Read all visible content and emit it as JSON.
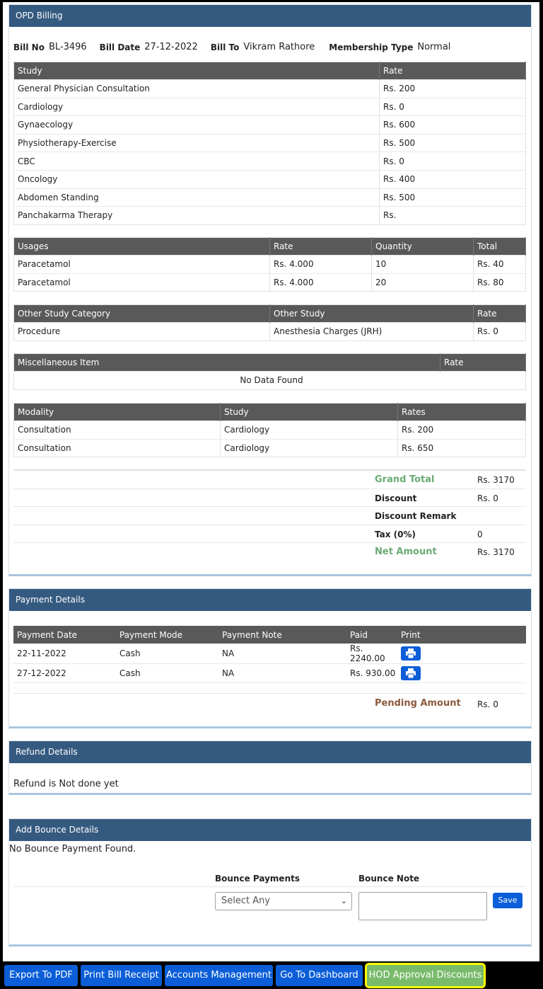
{
  "opd": {
    "title": "OPD Billing",
    "bill_no_label": "Bill No",
    "bill_no": "BL-3496",
    "bill_date_label": "Bill Date",
    "bill_date": "27-12-2022",
    "bill_to_label": "Bill To",
    "bill_to": "Vikram Rathore",
    "membership_label": "Membership Type",
    "membership": "Normal"
  },
  "study_table": {
    "headers": [
      "Study",
      "Rate"
    ],
    "rows": [
      [
        "General Physician Consultation",
        "Rs. 200"
      ],
      [
        "Cardiology",
        "Rs. 0"
      ],
      [
        "Gynaecology",
        "Rs. 600"
      ],
      [
        "Physiotherapy-Exercise",
        "Rs. 500"
      ],
      [
        "CBC",
        "Rs. 0"
      ],
      [
        "Oncology",
        "Rs. 400"
      ],
      [
        "Abdomen Standing",
        "Rs. 500"
      ],
      [
        "Panchakarma Therapy",
        "Rs."
      ]
    ]
  },
  "usages_table": {
    "headers": [
      "Usages",
      "Rate",
      "Quantity",
      "Total"
    ],
    "rows": [
      [
        "Paracetamol",
        "Rs. 4.000",
        "10",
        "Rs. 40"
      ],
      [
        "Paracetamol",
        "Rs. 4.000",
        "20",
        "Rs. 80"
      ]
    ]
  },
  "other_study_table": {
    "headers": [
      "Other Study Category",
      "Other Study",
      "Rate"
    ],
    "rows": [
      [
        "Procedure",
        "Anesthesia Charges (JRH)",
        "Rs. 0"
      ]
    ]
  },
  "misc_table": {
    "headers": [
      "Miscellaneous Item",
      "Rate"
    ],
    "empty": "No Data Found"
  },
  "modality_table": {
    "headers": [
      "Modality",
      "Study",
      "Rates"
    ],
    "rows": [
      [
        "Consultation",
        "Cardiology",
        "Rs. 200"
      ],
      [
        "Consultation",
        "Cardiology",
        "Rs. 650"
      ]
    ]
  },
  "totals": {
    "grand_total_label": "Grand Total",
    "grand_total": "Rs. 3170",
    "discount_label": "Discount",
    "discount": "Rs. 0",
    "discount_remark_label": "Discount Remark",
    "discount_remark": "",
    "tax_label": "Tax (0%)",
    "tax": "0",
    "net_amount_label": "Net Amount",
    "net_amount": "Rs. 3170"
  },
  "payment": {
    "title": "Payment Details",
    "headers": [
      "Payment Date",
      "Payment Mode",
      "Payment Note",
      "Paid",
      "Print"
    ],
    "rows": [
      [
        "22-11-2022",
        "Cash",
        "NA",
        "Rs. 2240.00"
      ],
      [
        "27-12-2022",
        "Cash",
        "NA",
        "Rs. 930.00"
      ]
    ],
    "pending_label": "Pending Amount",
    "pending": "Rs. 0",
    "print_icon": "printer-icon"
  },
  "refund": {
    "title": "Refund Details",
    "text": "Refund is Not done yet"
  },
  "bounce": {
    "title": "Add Bounce Details",
    "text": "No Bounce Payment Found.",
    "payments_label": "Bounce Payments",
    "note_label": "Bounce Note",
    "select_value": "Select Any",
    "save_label": "Save"
  },
  "footer": {
    "export_pdf": "Export To PDF",
    "print_receipt": "Print Bill Receipt",
    "accounts": "Accounts Management",
    "dashboard": "Go To Dashboard",
    "hod_approval": "HOD Approval Discounts"
  },
  "colors": {
    "header_blue": "#355a80",
    "table_head": "#595959",
    "primary_button": "#0b5ed7",
    "green_label": "#6aab74",
    "pending_label": "#8b5a3c",
    "highlight": "#ffff00"
  }
}
